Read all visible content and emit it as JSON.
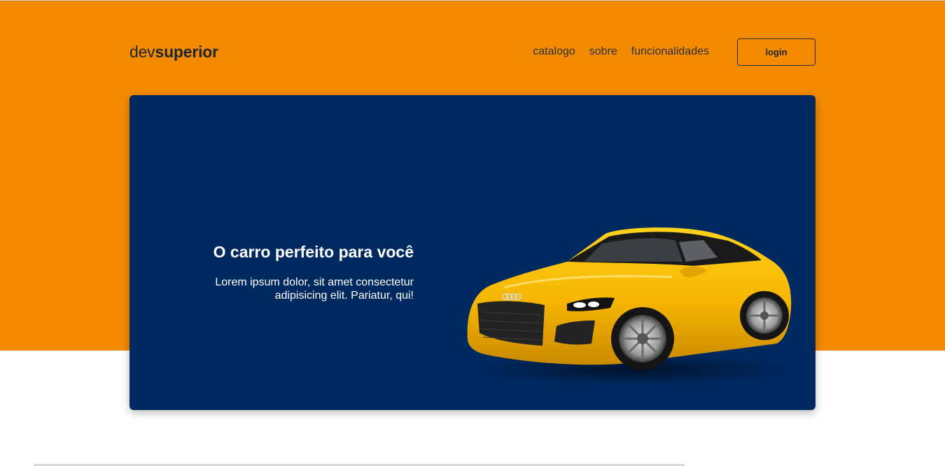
{
  "header": {
    "logo_light": "dev",
    "logo_bold": "superior",
    "nav": [
      {
        "label": "catalogo"
      },
      {
        "label": "sobre"
      },
      {
        "label": "funcionalidades"
      }
    ],
    "login_label": "login"
  },
  "hero": {
    "title": "O carro perfeito para você",
    "description": "Lorem ipsum dolor, sit amet consectetur adipisicing elit. Pariatur, qui!",
    "image": "yellow-sports-car"
  },
  "colors": {
    "background_orange": "#f48a00",
    "card_navy": "#002960",
    "car_yellow": "#f5b800"
  }
}
